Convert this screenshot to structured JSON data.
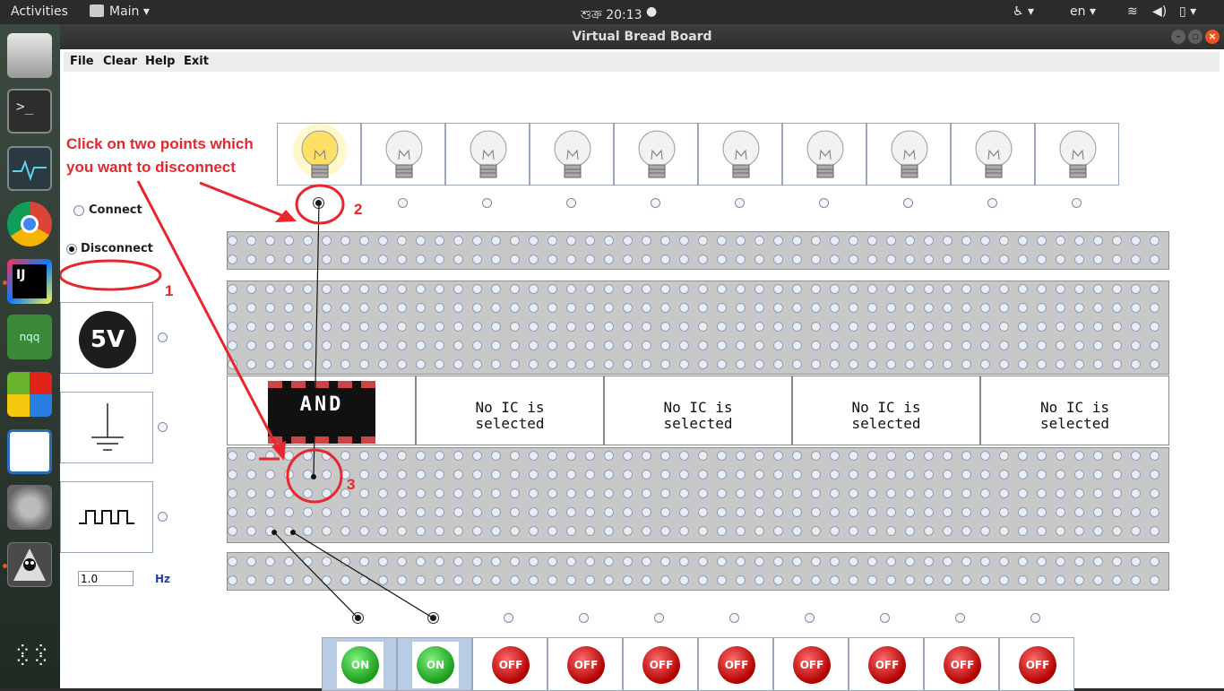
{
  "topbar": {
    "activities": "Activities",
    "app_menu": "Main",
    "clock": "শুক্র 20:13",
    "language": "en"
  },
  "window": {
    "title": "Virtual Bread Board"
  },
  "menu": {
    "file": "File",
    "clear": "Clear",
    "help": "Help",
    "exit": "Exit"
  },
  "mode": {
    "connect": "Connect",
    "disconnect": "Disconnect",
    "selected": "disconnect"
  },
  "sources": {
    "power_label": "5V",
    "frequency_value": "1.0",
    "frequency_unit": "Hz"
  },
  "ic_slots": [
    "AND",
    "No IC is\nselected",
    "No IC is\nselected",
    "No IC is\nselected",
    "No IC is\nselected"
  ],
  "bulbs": [
    true,
    false,
    false,
    false,
    false,
    false,
    false,
    false,
    false,
    false
  ],
  "switches": [
    {
      "label": "ON",
      "state": "on"
    },
    {
      "label": "ON",
      "state": "on"
    },
    {
      "label": "OFF",
      "state": "off"
    },
    {
      "label": "OFF",
      "state": "off"
    },
    {
      "label": "OFF",
      "state": "off"
    },
    {
      "label": "OFF",
      "state": "off"
    },
    {
      "label": "OFF",
      "state": "off"
    },
    {
      "label": "OFF",
      "state": "off"
    },
    {
      "label": "OFF",
      "state": "off"
    },
    {
      "label": "OFF",
      "state": "off"
    }
  ],
  "annotation": {
    "instruction": "Click on two points which\nyou want to disconnect",
    "step1": "1",
    "step2": "2",
    "step3": "3"
  },
  "colors": {
    "annotation_red": "#e8262c",
    "board_grey": "#c8c8c8",
    "window_title_bg": "#2f2f2f"
  }
}
